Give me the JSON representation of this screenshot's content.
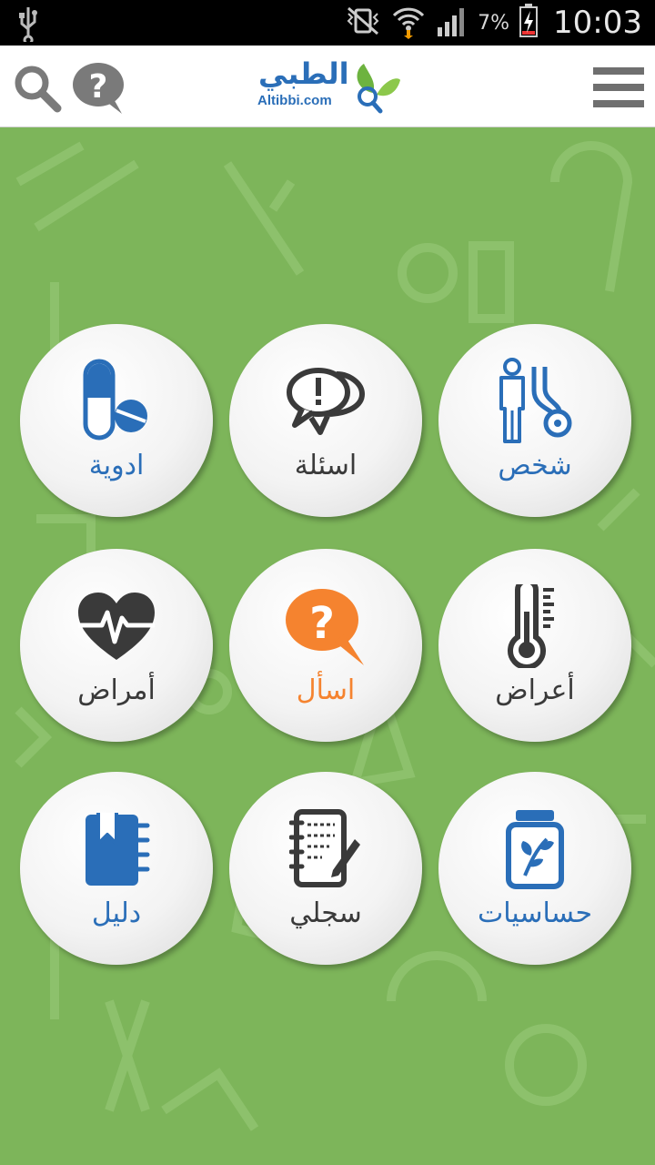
{
  "status_bar": {
    "battery_percent": "7%",
    "time": "10:03"
  },
  "header": {
    "logo_arabic": "الطبي",
    "logo_english": "Altibbi.com"
  },
  "colors": {
    "background_green": "#7db55a",
    "blue": "#2a6eb8",
    "orange": "#f5832f",
    "dark": "#3a3a3a"
  },
  "tiles": [
    {
      "label": "ادوية",
      "icon": "pill-icon",
      "color": "#2a6eb8"
    },
    {
      "label": "اسئلة",
      "icon": "speech-bubbles-icon",
      "color": "#3a3a3a"
    },
    {
      "label": "شخص",
      "icon": "person-stethoscope-icon",
      "color": "#2a6eb8"
    },
    {
      "label": "أمراض",
      "icon": "heart-pulse-icon",
      "color": "#3a3a3a"
    },
    {
      "label": "اسأل",
      "icon": "ask-question-icon",
      "color": "#f5832f"
    },
    {
      "label": "أعراض",
      "icon": "thermometer-icon",
      "color": "#3a3a3a"
    },
    {
      "label": "دليل",
      "icon": "directory-notebook-icon",
      "color": "#2a6eb8"
    },
    {
      "label": "سجلي",
      "icon": "notepad-pen-icon",
      "color": "#3a3a3a"
    },
    {
      "label": "حساسيات",
      "icon": "herb-jar-icon",
      "color": "#2a6eb8"
    }
  ]
}
